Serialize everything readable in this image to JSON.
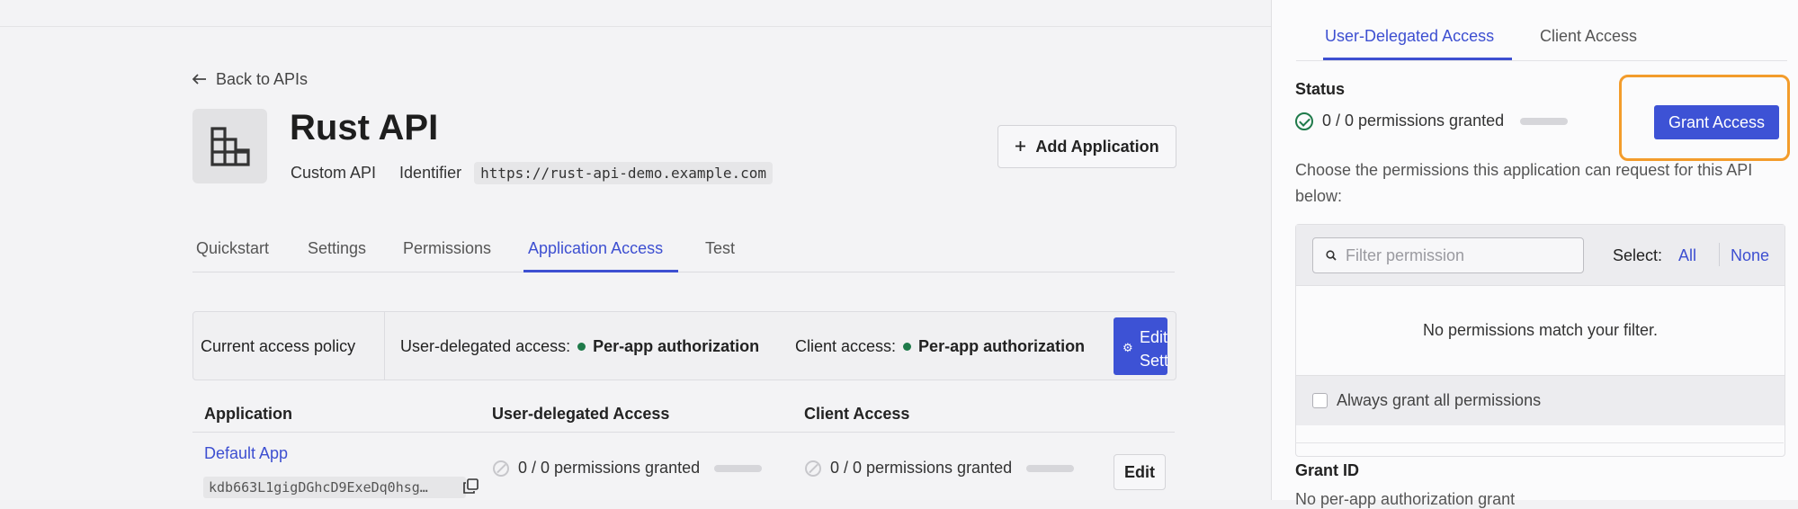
{
  "back_link": {
    "label": "Back to APIs"
  },
  "api": {
    "name": "Rust API",
    "type": "Custom API",
    "identifier_label": "Identifier",
    "identifier": "https://rust-api-demo.example.com"
  },
  "add_application": {
    "label": "Add Application"
  },
  "tabs": [
    "Quickstart",
    "Settings",
    "Permissions",
    "Application Access",
    "Test"
  ],
  "active_tab": "Application Access",
  "policy": {
    "label": "Current access policy",
    "user_delegated_label": "User-delegated access:",
    "user_delegated_value": "Per-app authorization",
    "client_label": "Client access:",
    "client_value": "Per-app authorization",
    "edit_button_line1": "Edit",
    "edit_button_line2": "Settings"
  },
  "table": {
    "headers": [
      "Application",
      "User-delegated Access",
      "Client Access"
    ],
    "rows": [
      {
        "name": "Default App",
        "client_id": "kdb663L1gigDGhcD9ExeDq0hsg…",
        "user_delegated": "0 / 0 permissions granted",
        "client": "0 / 0 permissions granted",
        "edit_label": "Edit"
      }
    ]
  },
  "panel": {
    "tabs": [
      "User-Delegated Access",
      "Client Access"
    ],
    "active_tab": "User-Delegated Access",
    "status_label": "Status",
    "status_value": "0 / 0 permissions granted",
    "grant_button": "Grant Access",
    "description": "Choose the permissions this application can request for this API below:",
    "filter_placeholder": "Filter permission",
    "select_label": "Select:",
    "select_all": "All",
    "select_none": "None",
    "empty_message": "No permissions match your filter.",
    "always_grant_label": "Always grant all permissions",
    "grant_id_label": "Grant ID",
    "grant_id_value": "No per-app authorization grant"
  },
  "colors": {
    "accent": "#3d52d5",
    "success": "#1f7a4a",
    "highlight": "#f39c2b"
  }
}
